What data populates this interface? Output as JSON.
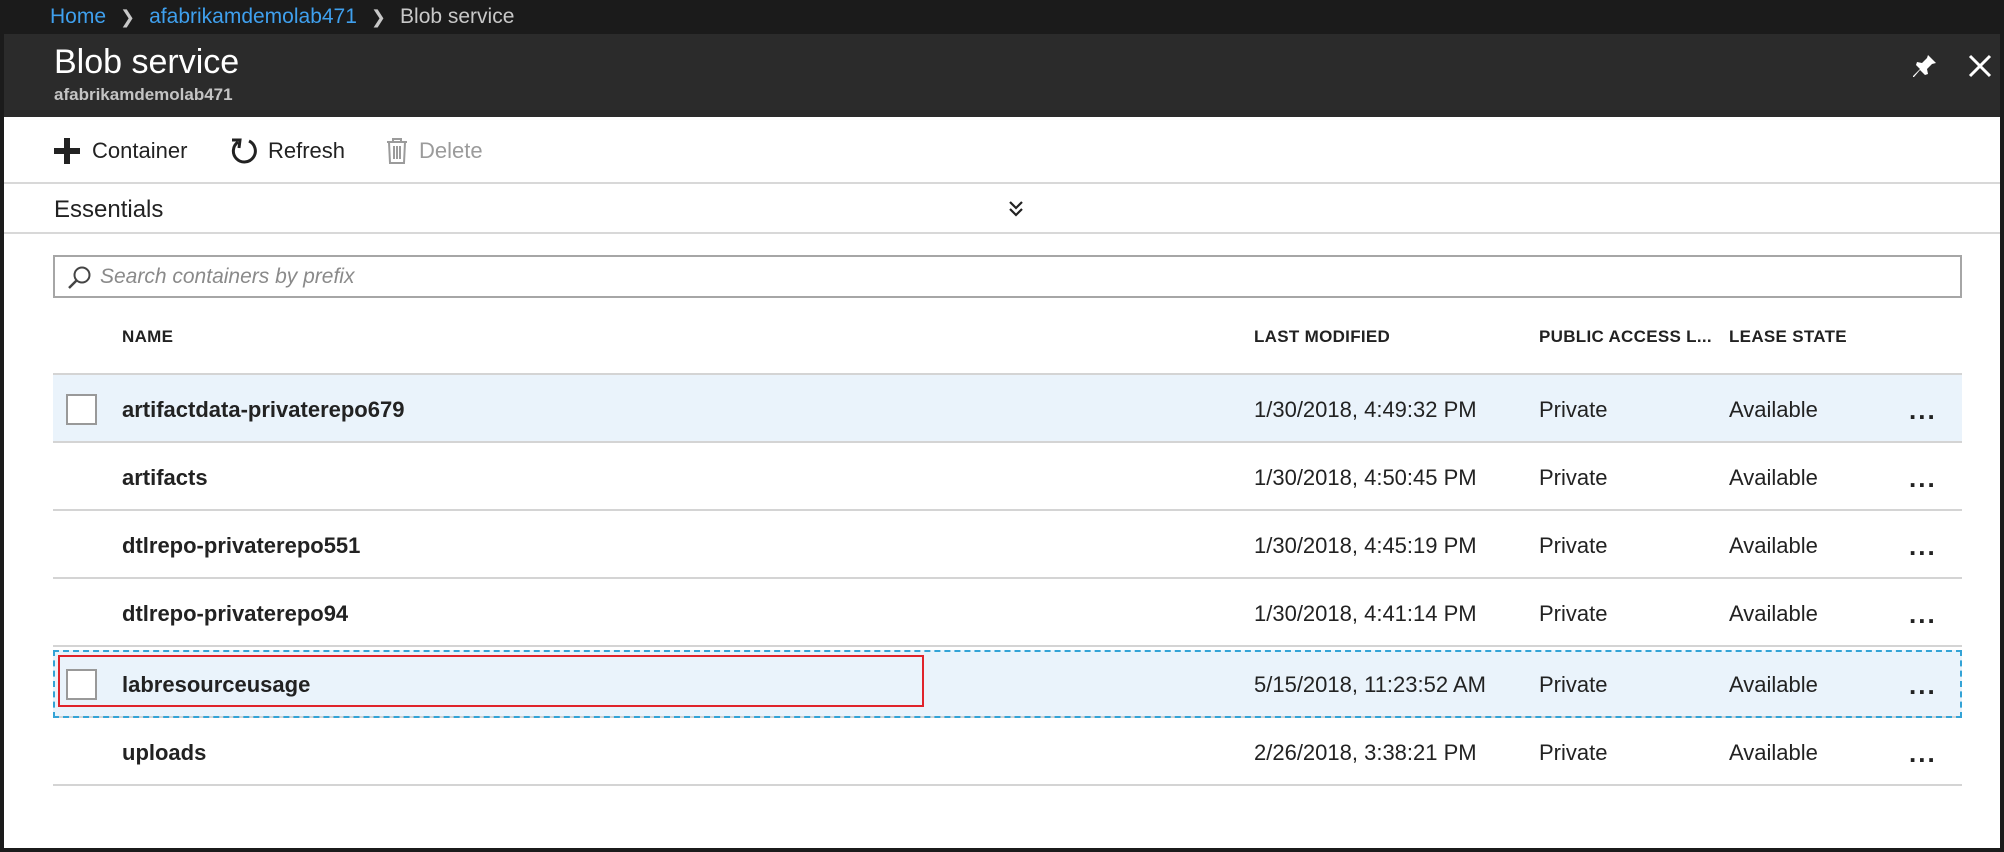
{
  "breadcrumb": {
    "items": [
      "Home",
      "afabrikamdemolab471",
      "Blob service"
    ]
  },
  "blade": {
    "title": "Blob service",
    "subtitle": "afabrikamdemolab471",
    "pin_icon": "pin-icon",
    "close_icon": "close-icon"
  },
  "toolbar": {
    "add_label": "Container",
    "refresh_label": "Refresh",
    "delete_label": "Delete"
  },
  "essentials": {
    "label": "Essentials"
  },
  "search": {
    "placeholder": "Search containers by prefix",
    "value": ""
  },
  "table": {
    "columns": [
      "NAME",
      "LAST MODIFIED",
      "PUBLIC ACCESS L...",
      "LEASE STATE"
    ],
    "rows": [
      {
        "name": "artifactdata-privaterepo679",
        "modified": "1/30/2018, 4:49:32 PM",
        "access": "Private",
        "lease": "Available",
        "more": "..."
      },
      {
        "name": "artifacts",
        "modified": "1/30/2018, 4:50:45 PM",
        "access": "Private",
        "lease": "Available",
        "more": "..."
      },
      {
        "name": "dtlrepo-privaterepo551",
        "modified": "1/30/2018, 4:45:19 PM",
        "access": "Private",
        "lease": "Available",
        "more": "..."
      },
      {
        "name": "dtlrepo-privaterepo94",
        "modified": "1/30/2018, 4:41:14 PM",
        "access": "Private",
        "lease": "Available",
        "more": "..."
      },
      {
        "name": "labresourceusage",
        "modified": "5/15/2018, 11:23:52 AM",
        "access": "Private",
        "lease": "Available",
        "more": "..."
      },
      {
        "name": "uploads",
        "modified": "2/26/2018, 3:38:21 PM",
        "access": "Private",
        "lease": "Available",
        "more": "..."
      }
    ]
  },
  "colors": {
    "accent": "#3fa0ee",
    "header_bg": "#2b2b2b",
    "breadcrumb_bg": "#1b1b1b",
    "row_hover_bg": "#eaf3fb",
    "selection_dashed": "#33a3d6",
    "highlight_red": "#e0232a"
  }
}
